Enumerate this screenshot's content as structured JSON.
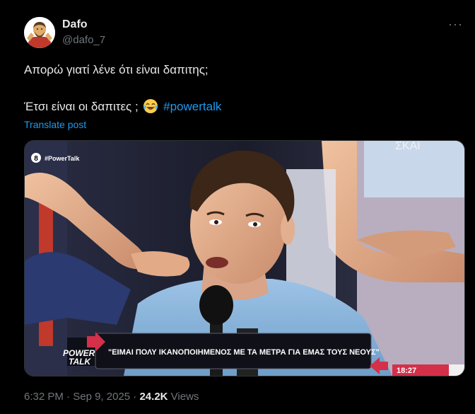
{
  "author": {
    "display_name": "Dafo",
    "handle": "@dafo_7",
    "avatar_icon": "shrug-avatar-icon"
  },
  "tweet": {
    "line1": "Απορώ γιατί λένε ότι είναι δαπιτης;",
    "line2_text": "Έτσι είναι οι δαπιτες ;",
    "line2_emoji": "tears-of-joy-emoji",
    "hashtag": "#powertalk",
    "translate_label": "Translate post"
  },
  "media": {
    "channel_tag": "#PowerTalk",
    "channel_number": "8",
    "backdrop_text": "ΣΚΑΙ",
    "caption": "\"ΕΙΜΑΙ ΠΟΛΥ ΙΚΑΝΟΠΟΙΗΜΕΝΟΣ ΜΕ ΤΑ ΜΕΤΡΑ ΓΙΑ ΕΜΑΣ ΤΟΥΣ ΝΕΟΥΣ\"",
    "logo_line1": "POWER",
    "logo_line2": "TALK",
    "clock": "18:27"
  },
  "meta": {
    "time": "6:32 PM",
    "separator": "·",
    "date": "Sep 9, 2025",
    "views_count": "24.2K",
    "views_label": "Views"
  },
  "colors": {
    "accent": "#1d9bf0",
    "muted": "#71767b",
    "text": "#e7e9ea",
    "tv_red": "#d4304a"
  },
  "more_icon": "more-horizontal-icon"
}
